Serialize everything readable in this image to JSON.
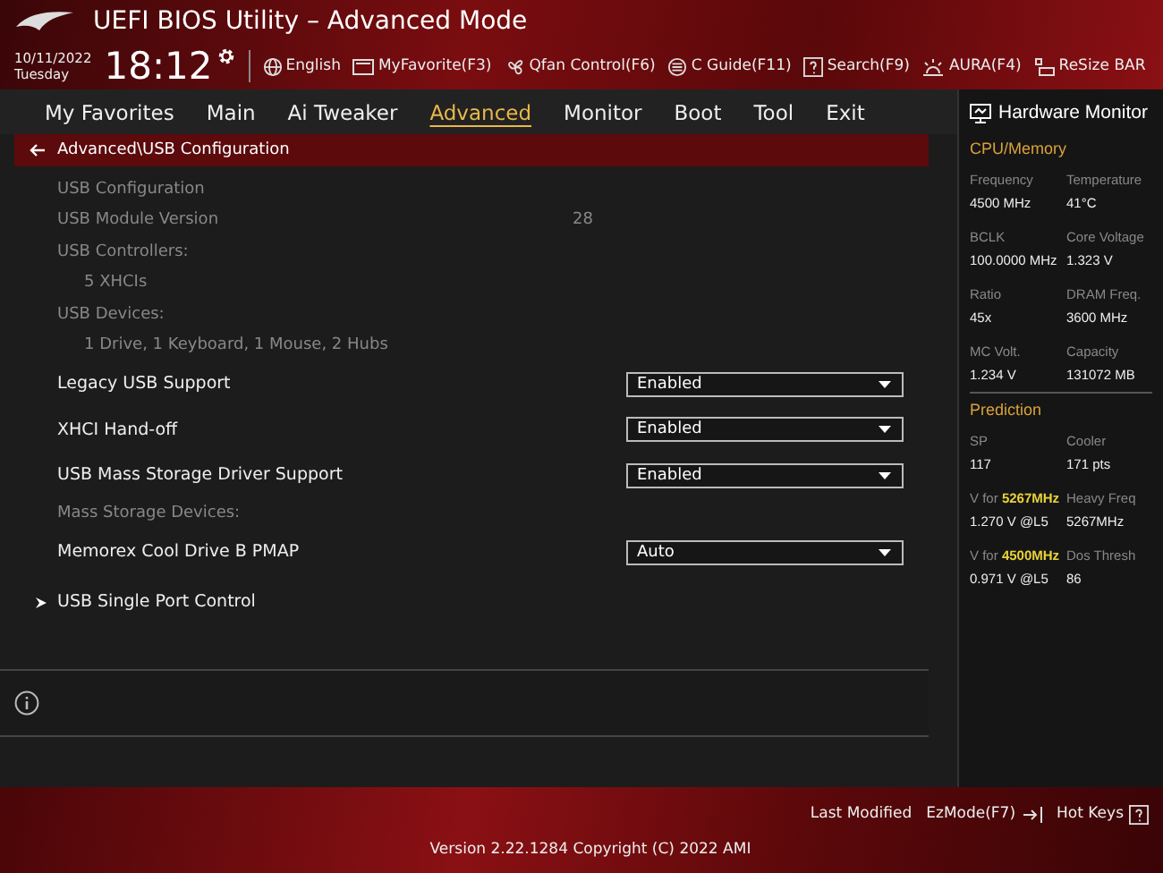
{
  "header": {
    "title": "UEFI BIOS Utility – Advanced Mode",
    "date": "10/11/2022",
    "day": "Tuesday",
    "time": "18:12",
    "tools": [
      {
        "label": "English"
      },
      {
        "label": "MyFavorite(F3)"
      },
      {
        "label": "Qfan Control(F6)"
      },
      {
        "label": "C Guide(F11)"
      },
      {
        "label": "Search(F9)"
      },
      {
        "label": "AURA(F4)"
      },
      {
        "label": "ReSize BAR"
      }
    ]
  },
  "tabs": [
    {
      "label": "My Favorites",
      "selected": false
    },
    {
      "label": "Main",
      "selected": false
    },
    {
      "label": "Ai Tweaker",
      "selected": false
    },
    {
      "label": "Advanced",
      "selected": true
    },
    {
      "label": "Monitor",
      "selected": false
    },
    {
      "label": "Boot",
      "selected": false
    },
    {
      "label": "Tool",
      "selected": false
    },
    {
      "label": "Exit",
      "selected": false
    }
  ],
  "breadcrumb": "Advanced\\USB Configuration",
  "items": [
    {
      "kind": "info",
      "label": "USB Configuration"
    },
    {
      "kind": "info",
      "label": "USB Module Version",
      "value": "28"
    },
    {
      "kind": "info",
      "label": "USB Controllers:"
    },
    {
      "kind": "sub",
      "label": "5 XHCIs"
    },
    {
      "kind": "info",
      "label": "USB Devices:"
    },
    {
      "kind": "sub",
      "label": "1 Drive, 1 Keyboard, 1 Mouse, 2 Hubs"
    },
    {
      "kind": "setting",
      "label": "Legacy USB Support",
      "value": "Enabled"
    },
    {
      "kind": "setting",
      "label": "XHCI Hand-off",
      "value": "Enabled"
    },
    {
      "kind": "setting",
      "label": "USB Mass Storage Driver Support",
      "value": "Enabled"
    },
    {
      "kind": "info",
      "label": "Mass Storage Devices:"
    },
    {
      "kind": "setting",
      "label": "Memorex Cool Drive B PMAP",
      "value": "Auto"
    },
    {
      "kind": "submenu",
      "label": "USB Single Port Control"
    }
  ],
  "hardware_monitor": {
    "title": "Hardware Monitor",
    "sections": [
      {
        "title": "CPU/Memory",
        "cells": [
          {
            "label": "Frequency",
            "value": "4500 MHz"
          },
          {
            "label": "Temperature",
            "value": "41°C"
          },
          {
            "label": "BCLK",
            "value": "100.0000 MHz"
          },
          {
            "label": "Core Voltage",
            "value": "1.323 V"
          },
          {
            "label": "Ratio",
            "value": "45x"
          },
          {
            "label": "DRAM Freq.",
            "value": "3600 MHz"
          },
          {
            "label": "MC Volt.",
            "value": "1.234 V"
          },
          {
            "label": "Capacity",
            "value": "131072 MB"
          }
        ]
      },
      {
        "title": "Prediction",
        "cells": [
          {
            "label": "SP",
            "value": "117"
          },
          {
            "label": "Cooler",
            "value": "171 pts"
          },
          {
            "label": "V for **5267MHz**",
            "value": "1.270 V @L5"
          },
          {
            "label": "Heavy Freq",
            "value": "5267MHz"
          },
          {
            "label": "V for **4500MHz**",
            "value": "0.971 V @L5"
          },
          {
            "label": "Dos Thresh",
            "value": "86"
          }
        ]
      }
    ]
  },
  "footer": {
    "actions": [
      {
        "label": "Last Modified"
      },
      {
        "label": "EzMode(F7)"
      },
      {
        "label": "Hot Keys"
      }
    ],
    "version": "Version 2.22.1284 Copyright (C) 2022 AMI"
  }
}
